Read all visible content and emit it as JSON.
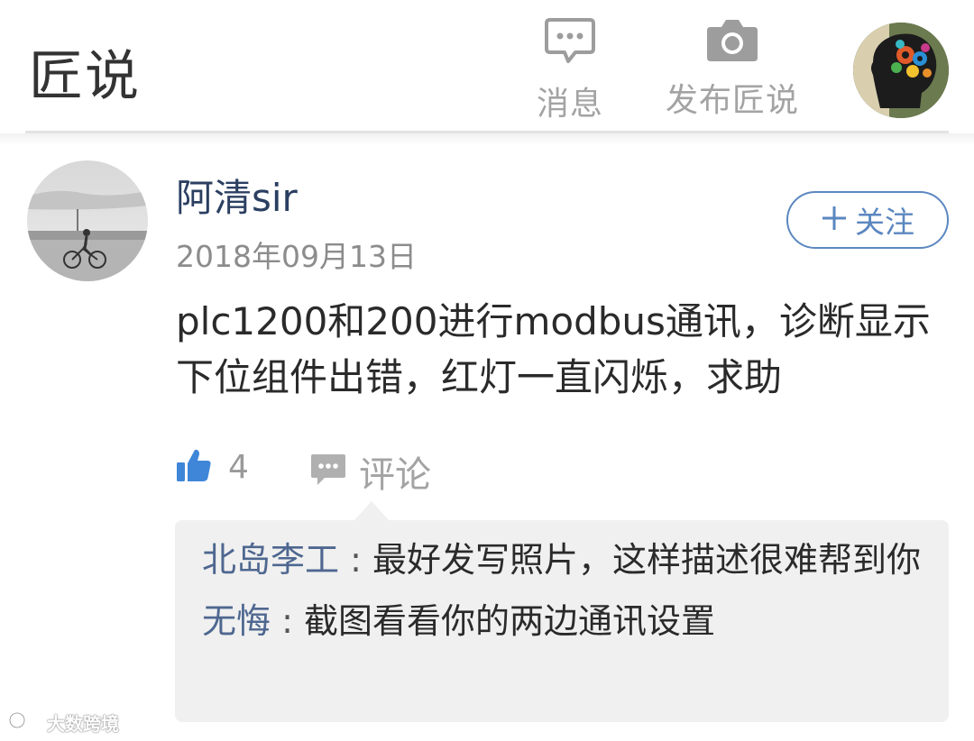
{
  "header": {
    "app_title": "匠说",
    "nav": {
      "messages": {
        "label": "消息",
        "icon": "chat-bubble-icon"
      },
      "publish": {
        "label": "发布匠说",
        "icon": "camera-icon"
      }
    },
    "avatar_icon": "brain-gears-avatar"
  },
  "post": {
    "author": "阿清sir",
    "date": "2018年09月13日",
    "follow_label": "关注",
    "content": "plc1200和200进行modbus通讯，诊断显示下位组件出错，红灯一直闪烁，求助",
    "likes": "4",
    "comment_label": "评论",
    "like_icon": "thumbs-up-icon",
    "comment_icon": "comment-icon"
  },
  "comments": [
    {
      "author": "北岛李工",
      "separator": " : ",
      "text": "最好发写照片，这样描述很难帮到你"
    },
    {
      "author": "无悔",
      "separator": " : ",
      "text": "截图看看你的两边通讯设置"
    }
  ],
  "watermark": {
    "text": "大数跨境"
  },
  "colors": {
    "accent": "#5b87c0",
    "author_name": "#2b3f61",
    "comment_author": "#4e6790",
    "like_icon": "#3f86d8",
    "muted": "#a3a3a3",
    "comment_bg": "#f0f0f0"
  }
}
